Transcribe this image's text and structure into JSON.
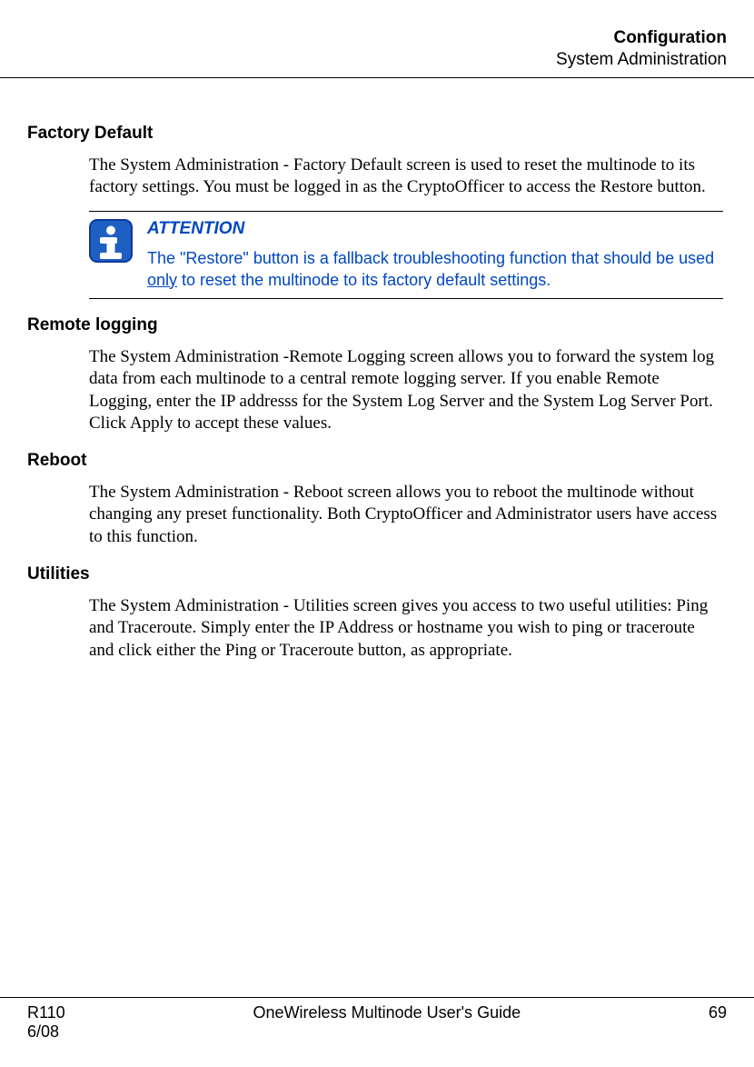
{
  "header": {
    "line1": "Configuration",
    "line2": "System Administration"
  },
  "sections": {
    "factory_default": {
      "heading": "Factory Default",
      "body": "The System Administration - Factory Default screen is used to reset the multinode to its factory settings.  You must be logged in as the CryptoOfficer to access the Restore button."
    },
    "attention": {
      "title": "ATTENTION",
      "body_pre": "The \"Restore\" button is a fallback troubleshooting function that should be used ",
      "body_underline": "only",
      "body_post": " to reset the multinode to its factory default settings."
    },
    "remote_logging": {
      "heading": "Remote logging",
      "body": "The System Administration -Remote Logging screen allows you to forward the system log data from each multinode to a central remote logging server.  If you enable Remote Logging, enter the IP addresss for the System Log Server and the System Log Server Port. Click Apply to accept these values."
    },
    "reboot": {
      "heading": "Reboot",
      "body": "The System Administration - Reboot screen allows you to reboot the multinode without changing any preset functionality. Both CryptoOfficer and Administrator users have access to this function."
    },
    "utilities": {
      "heading": "Utilities",
      "body": "The System Administration - Utilities screen gives you access to two useful utilities: Ping and Traceroute. Simply enter the IP Address or hostname you wish to ping or traceroute and click either the Ping or Traceroute button, as appropriate."
    }
  },
  "footer": {
    "left1": "R110",
    "left2": "6/08",
    "center": "OneWireless Multinode User's Guide",
    "right": "69"
  }
}
